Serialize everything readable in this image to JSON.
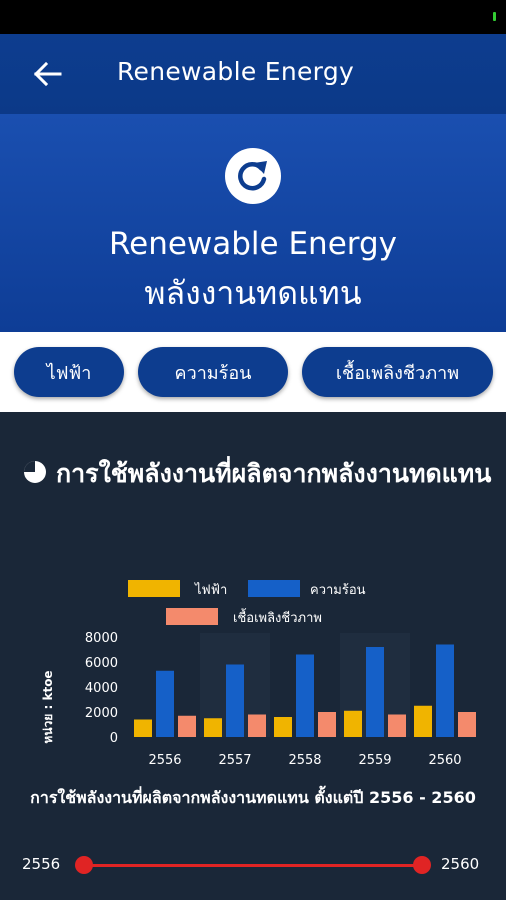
{
  "app_bar": {
    "title": "Renewable Energy"
  },
  "hero": {
    "title_en": "Renewable Energy",
    "title_th": "พลังงานทดแทน",
    "icon": "refresh-icon"
  },
  "tabs": [
    {
      "label": "ไฟฟ้า"
    },
    {
      "label": "ความร้อน"
    },
    {
      "label": "เชื้อเพลิงชีวภาพ"
    }
  ],
  "section": {
    "title": "การใช้พลังงานที่ผลิตจากพลังงานทดแทน",
    "icon": "pie-chart-icon"
  },
  "colors": {
    "electricity": "#f0b400",
    "heat": "#1560c8",
    "biofuel": "#f48a6c",
    "accent": "#0d3d8f",
    "slider": "#e02424"
  },
  "chart_data": {
    "type": "bar",
    "categories": [
      "2556",
      "2557",
      "2558",
      "2559",
      "2560"
    ],
    "series": [
      {
        "name": "ไฟฟ้า",
        "values": [
          1400,
          1500,
          1600,
          2100,
          2500
        ]
      },
      {
        "name": "ความร้อน",
        "values": [
          5300,
          5800,
          6600,
          7200,
          7400
        ]
      },
      {
        "name": "เชื้อเพลิงชีวภาพ",
        "values": [
          1700,
          1800,
          2000,
          1800,
          2000
        ]
      }
    ],
    "ylabel": "หน่วย : ktoe",
    "yticks": [
      0,
      2000,
      4000,
      6000,
      8000
    ],
    "ylim": [
      0,
      8000
    ],
    "legend_position": "top",
    "grid": false
  },
  "caption": "การใช้พลังงานที่ผลิตจากพลังงานทดแทน ตั้งแต่ปี 2556 - 2560",
  "range": {
    "min_label": "2556",
    "max_label": "2560",
    "start": "2556",
    "end": "2560"
  }
}
